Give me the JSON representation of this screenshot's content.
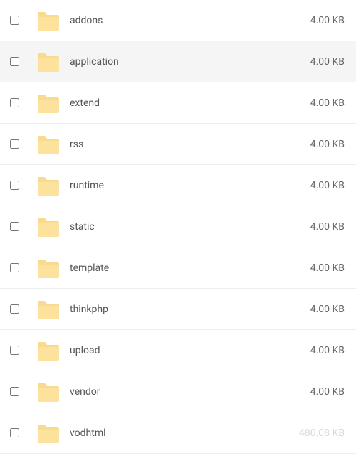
{
  "files": [
    {
      "name": "addons",
      "size": "4.00 KB",
      "selected": false
    },
    {
      "name": "application",
      "size": "4.00 KB",
      "selected": true
    },
    {
      "name": "extend",
      "size": "4.00 KB",
      "selected": false
    },
    {
      "name": "rss",
      "size": "4.00 KB",
      "selected": false
    },
    {
      "name": "runtime",
      "size": "4.00 KB",
      "selected": false
    },
    {
      "name": "static",
      "size": "4.00 KB",
      "selected": false
    },
    {
      "name": "template",
      "size": "4.00 KB",
      "selected": false
    },
    {
      "name": "thinkphp",
      "size": "4.00 KB",
      "selected": false
    },
    {
      "name": "upload",
      "size": "4.00 KB",
      "selected": false
    },
    {
      "name": "vendor",
      "size": "4.00 KB",
      "selected": false
    },
    {
      "name": "vodhtml",
      "size": "480.08 KB",
      "selected": false,
      "faded": true
    }
  ]
}
